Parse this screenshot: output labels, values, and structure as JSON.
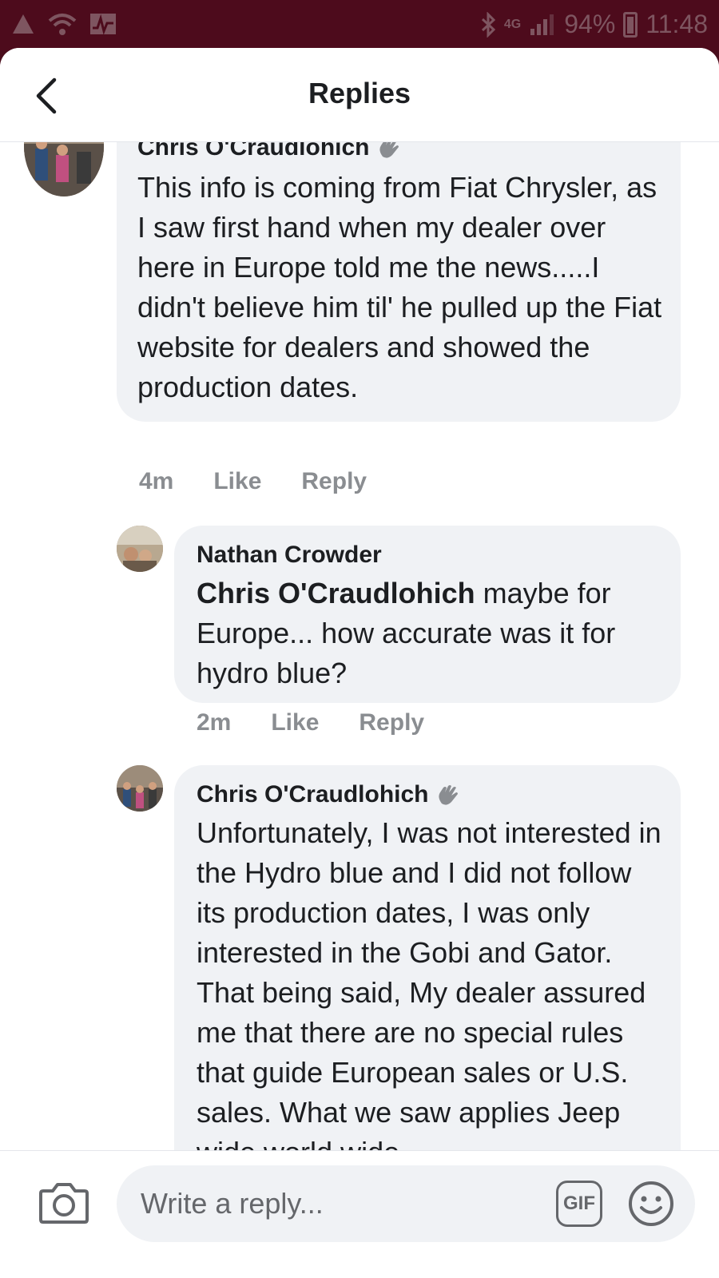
{
  "status_bar": {
    "network": "4G",
    "battery": "94%",
    "time": "11:48",
    "icons": [
      "alert-triangle-icon",
      "wifi-icon",
      "activity-icon",
      "bluetooth-icon",
      "signal-icon",
      "battery-icon"
    ]
  },
  "header": {
    "title": "Replies",
    "back_icon": "chevron-left-icon"
  },
  "comments": [
    {
      "author": "Chris O'Craudlohich",
      "author_visible": "Chris O'Craudlohich",
      "badge_icon": "wave-hand-icon",
      "text": "This info is coming from Fiat Chrysler, as I saw first hand when my dealer over here in Europe told me the news.....I didn't believe him til' he pulled up the Fiat website for dealers and showed the production dates.",
      "time": "4m",
      "like": "Like",
      "reply": "Reply"
    },
    {
      "author": "Nathan Crowder",
      "mention": "Chris O'Craudlohich",
      "text": " maybe for Europe... how accurate was it for hydro blue?",
      "time": "2m",
      "like": "Like",
      "reply": "Reply"
    },
    {
      "author": "Chris O'Craudlohich",
      "badge_icon": "wave-hand-icon",
      "text": "Unfortunately, I was not interested in the Hydro blue and I did not follow its production dates, I was only interested in the Gobi and Gator.  That being said, My dealer assured me that there are no special rules that guide European sales or U.S. sales.  What we saw applies Jeep wide world wide."
    }
  ],
  "composer": {
    "placeholder": "Write a reply...",
    "gif_label": "GIF",
    "camera_icon": "camera-icon",
    "emoji_icon": "smiley-icon"
  }
}
